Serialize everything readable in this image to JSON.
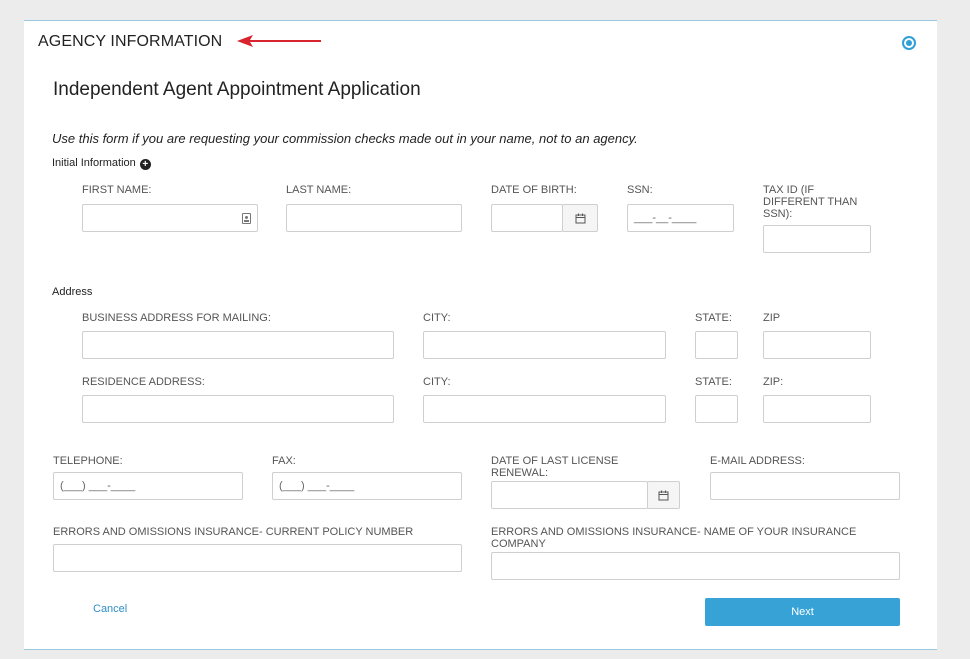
{
  "section": {
    "title": "AGENCY INFORMATION"
  },
  "form": {
    "title": "Independent Agent Appointment Application",
    "instructions": "Use this form if you are requesting your commission checks made out in your name, not to an agency."
  },
  "initial": {
    "label": "Initial Information",
    "first_name": "FIRST NAME:",
    "last_name": "LAST NAME:",
    "dob": "DATE OF BIRTH:",
    "ssn": "SSN:",
    "ssn_mask": "___-__-____",
    "tax_id_line1": "TAX ID (IF",
    "tax_id_line2": "DIFFERENT THAN",
    "tax_id_line3": "SSN):"
  },
  "address": {
    "label": "Address",
    "business": "BUSINESS ADDRESS FOR MAILING:",
    "city1": "CITY:",
    "state1": "STATE:",
    "zip1": "ZIP",
    "residence": "RESIDENCE ADDRESS:",
    "city2": "CITY:",
    "state2": "STATE:",
    "zip2": "ZIP:"
  },
  "contact": {
    "telephone": "TELEPHONE:",
    "phone_mask": "(___) ___-____",
    "fax": "FAX:",
    "fax_mask": "(___) ___-____",
    "license_line1": "DATE OF LAST LICENSE",
    "license_line2": "RENEWAL:",
    "email": "E-MAIL ADDRESS:"
  },
  "insurance": {
    "policy": "ERRORS AND OMISSIONS INSURANCE- CURRENT POLICY NUMBER",
    "company_line1": "ERRORS AND OMISSIONS INSURANCE- NAME OF YOUR INSURANCE",
    "company_line2": "COMPANY"
  },
  "actions": {
    "cancel": "Cancel",
    "next": "Next"
  },
  "colors": {
    "accent": "#36a2d6",
    "arrow": "#d9232e",
    "link": "#2f8fc4"
  }
}
